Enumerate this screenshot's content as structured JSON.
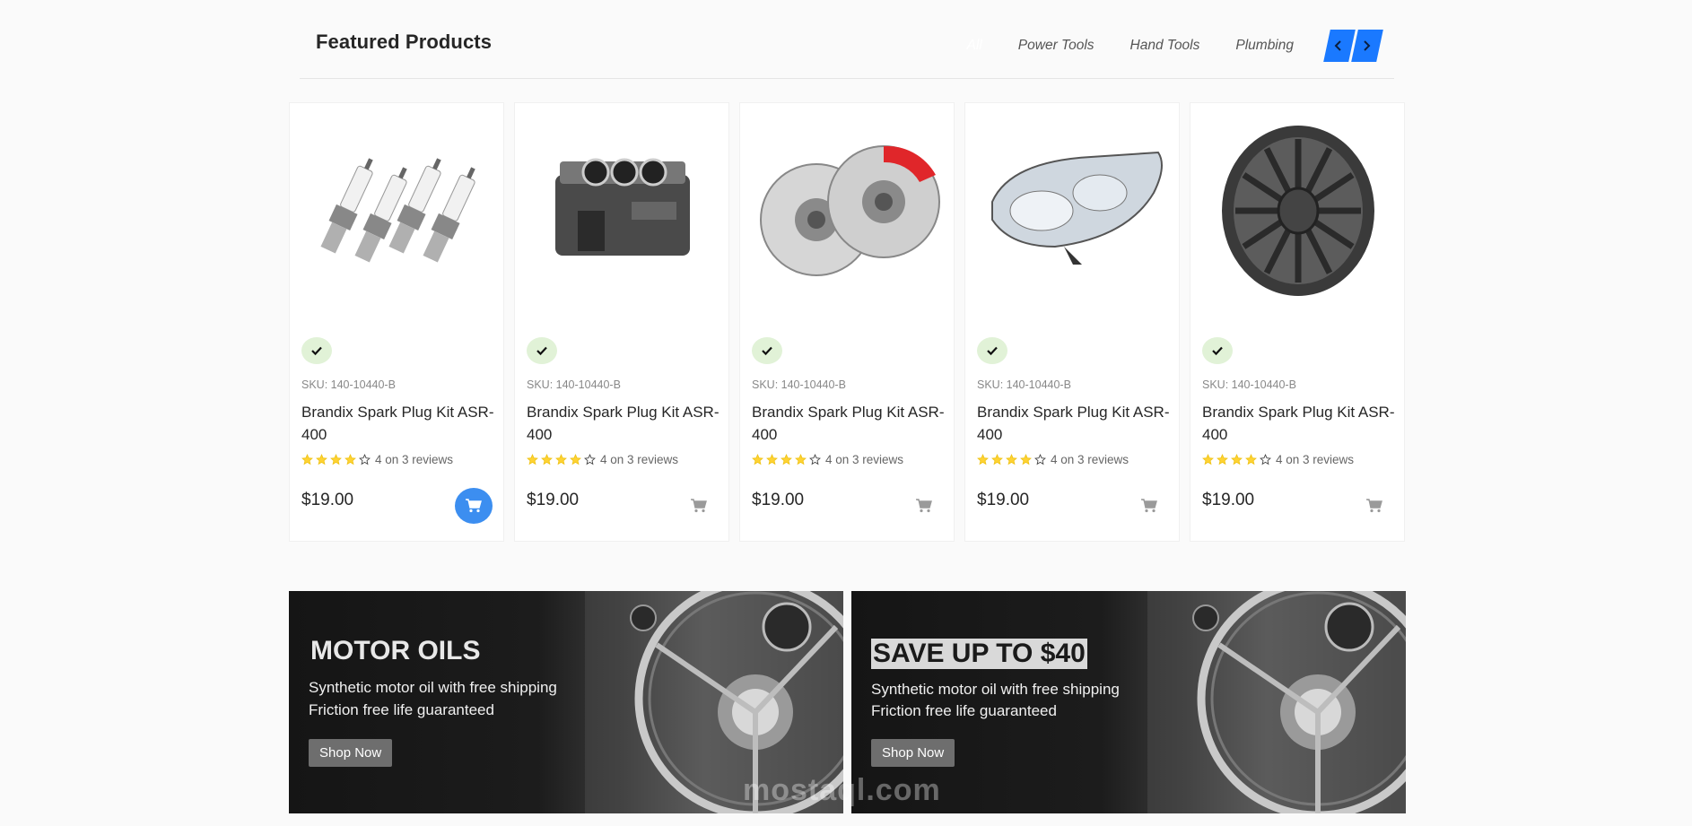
{
  "header": {
    "title": "Featured Products",
    "tabs": [
      "All",
      "Power Tools",
      "Hand Tools",
      "Plumbing"
    ],
    "active_tab": "All"
  },
  "accent_color": "#1a79ff",
  "products": [
    {
      "image": "spark-plugs",
      "in_stock": true,
      "sku": "SKU: 140-10440-B",
      "name": "Brandix Spark Plug Kit ASR-400",
      "rating": 4,
      "reviews": "4 on 3 reviews",
      "price": "$19.00",
      "cart_highlighted": true
    },
    {
      "image": "engine-block",
      "in_stock": true,
      "sku": "SKU: 140-10440-B",
      "name": "Brandix Spark Plug Kit ASR-400",
      "rating": 4,
      "reviews": "4 on 3 reviews",
      "price": "$19.00",
      "cart_highlighted": false
    },
    {
      "image": "brake-discs",
      "in_stock": true,
      "sku": "SKU: 140-10440-B",
      "name": "Brandix Spark Plug Kit ASR-400",
      "rating": 4,
      "reviews": "4 on 3 reviews",
      "price": "$19.00",
      "cart_highlighted": false
    },
    {
      "image": "headlight",
      "in_stock": true,
      "sku": "SKU: 140-10440-B",
      "name": "Brandix Spark Plug Kit ASR-400",
      "rating": 4,
      "reviews": "4 on 3 reviews",
      "price": "$19.00",
      "cart_highlighted": false
    },
    {
      "image": "wheel-rim",
      "in_stock": true,
      "sku": "SKU: 140-10440-B",
      "name": "Brandix Spark Plug Kit ASR-400",
      "rating": 4,
      "reviews": "4 on 3 reviews",
      "price": "$19.00",
      "cart_highlighted": false
    }
  ],
  "banners": [
    {
      "title": "MOTOR OILS",
      "line1": "Synthetic motor oil with free shipping",
      "line2": "Friction free life guaranteed",
      "button": "Shop Now",
      "highlight_title": false
    },
    {
      "title": "SAVE UP TO $40",
      "line1": "Synthetic motor oil with free shipping",
      "line2": "Friction free life guaranteed",
      "button": "Shop Now",
      "highlight_title": true
    }
  ],
  "watermark": "mostaql.com"
}
